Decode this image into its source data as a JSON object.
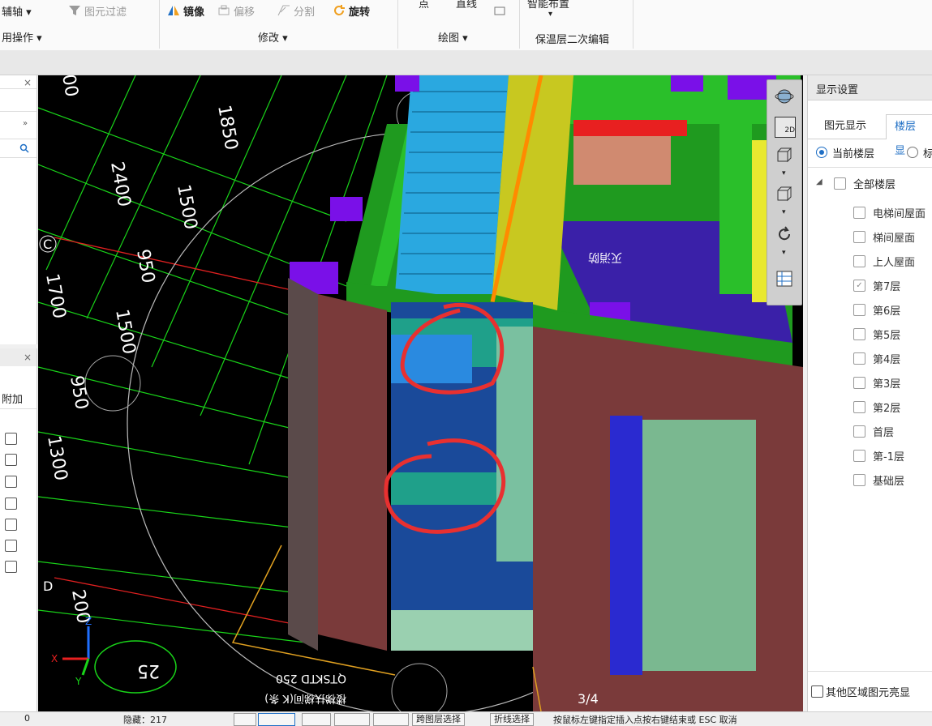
{
  "ribbon": {
    "aux_axis": "辅轴 ▾",
    "common_ops": "用操作 ▾",
    "elem_filter": "图元过滤",
    "mirror": "镜像",
    "offset": "偏移",
    "split": "分割",
    "rotate": "旋转",
    "modify": "修改 ▾",
    "point": "点",
    "line": "直线",
    "draw": "绘图 ▾",
    "smart_layout": "智能布置",
    "insulation": "保温层二次编辑"
  },
  "viewport": {
    "dims": [
      "1850",
      "2400",
      "1500",
      "950",
      "1700",
      "1500",
      "950",
      "1300",
      "200",
      "25"
    ],
    "axis_c": "C",
    "axis_d": "D",
    "handwritten_text": "灭消防",
    "page_indicator": "3/4",
    "bottom_text": "QTSKTD 250",
    "bottom_text2": "楼梯扶梯间(K 条)"
  },
  "view_toolbar": {
    "btn_2d": "2D"
  },
  "right_panel": {
    "title": "显示设置",
    "tab_elem": "图元显示",
    "tab_floor": "楼层显",
    "radio_current": "当前楼层",
    "radio_other": "标",
    "all_floors": "全部楼层",
    "floors": [
      {
        "label": "电梯间屋面",
        "checked": false
      },
      {
        "label": "梯间屋面",
        "checked": false
      },
      {
        "label": "上人屋面",
        "checked": false
      },
      {
        "label": "第7层",
        "checked": true
      },
      {
        "label": "第6层",
        "checked": false
      },
      {
        "label": "第5层",
        "checked": false
      },
      {
        "label": "第4层",
        "checked": false
      },
      {
        "label": "第3层",
        "checked": false
      },
      {
        "label": "第2层",
        "checked": false
      },
      {
        "label": "首层",
        "checked": false
      },
      {
        "label": "第-1层",
        "checked": false
      },
      {
        "label": "基础层",
        "checked": false
      }
    ],
    "other_area": "其他区域图元亮显"
  },
  "left_panel": {
    "attach": "附加",
    "close": "×"
  },
  "status": {
    "left_num": "0",
    "height": "隐藏：217",
    "cross_floor": "跨图层选择",
    "polyline": "折线选择",
    "hint": "按鼠标左键指定插入点按右键结束或 ESC 取消"
  }
}
